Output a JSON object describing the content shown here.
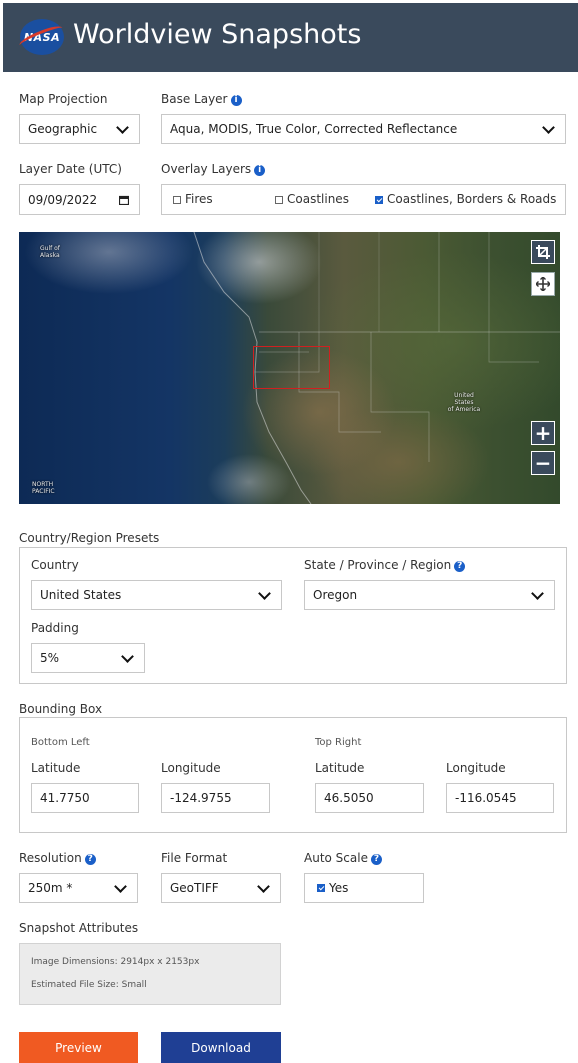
{
  "header": {
    "logo_text": "NASA",
    "title": "Worldview Snapshots"
  },
  "map_projection": {
    "label": "Map Projection",
    "value": "Geographic"
  },
  "base_layer": {
    "label": "Base Layer",
    "value": "Aqua, MODIS, True Color, Corrected Reflectance",
    "info_icon": "info-circle-icon"
  },
  "layer_date": {
    "label": "Layer Date (UTC)",
    "value": "09/09/2022",
    "icon": "calendar-icon"
  },
  "overlay_layers": {
    "label": "Overlay Layers",
    "items": [
      {
        "label": "Fires",
        "checked": false
      },
      {
        "label": "Coastlines",
        "checked": false
      },
      {
        "label": "Coastlines, Borders & Roads",
        "checked": true
      }
    ]
  },
  "map": {
    "labels": {
      "gulf_line1": "Gulf of",
      "gulf_line2": "Alaska",
      "us_line1": "United",
      "us_line2": "States",
      "us_line3": "of America",
      "pacific_line1": "NORTH",
      "pacific_line2": "PACIFIC"
    },
    "controls": {
      "crop": "crop-icon",
      "pan": "move-icon",
      "zoom_in": "+",
      "zoom_out": "−"
    },
    "highlight_color": "#d02020"
  },
  "presets": {
    "title": "Country/Region Presets",
    "country": {
      "label": "Country",
      "value": "United States"
    },
    "region": {
      "label": "State / Province / Region",
      "value": "Oregon"
    },
    "padding": {
      "label": "Padding",
      "value": "5%"
    }
  },
  "bounding_box": {
    "title": "Bounding Box",
    "bottom_left": {
      "label": "Bottom Left",
      "lat_label": "Latitude",
      "lon_label": "Longitude",
      "lat": "41.7750",
      "lon": "-124.9755"
    },
    "top_right": {
      "label": "Top Right",
      "lat_label": "Latitude",
      "lon_label": "Longitude",
      "lat": "46.5050",
      "lon": "-116.0545"
    }
  },
  "resolution": {
    "label": "Resolution",
    "value": "250m *"
  },
  "file_format": {
    "label": "File Format",
    "value": "GeoTIFF"
  },
  "auto_scale": {
    "label": "Auto Scale",
    "value": "Yes",
    "checked": true
  },
  "snapshot_attributes": {
    "title": "Snapshot Attributes",
    "dimensions_label": "Image Dimensions:",
    "dimensions_value": "2914px x 2153px",
    "filesize_label": "Estimated File Size:",
    "filesize_value": "Small"
  },
  "actions": {
    "preview": "Preview",
    "download": "Download"
  },
  "colors": {
    "header": "#3a4a5c",
    "accent": "#1a5fc8",
    "preview": "#f05a22",
    "download": "#1f3f94"
  }
}
